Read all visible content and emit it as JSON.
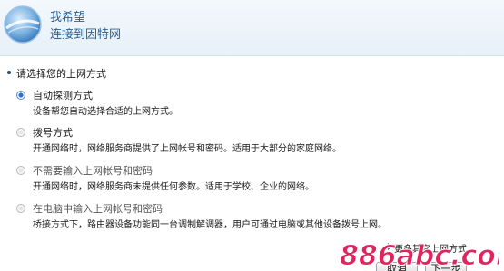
{
  "header": {
    "line1": "我希望",
    "line2": "连接到因特网"
  },
  "prompt": "请选择您的上网方式",
  "options": [
    {
      "title": "自动探测方式",
      "desc": "设备帮您自动选择合适的上网方式。",
      "selected": true
    },
    {
      "title": "拨号方式",
      "desc": "开通网络时，网络服务商提供了上网帐号和密码。适用于大部分的家庭网络。",
      "selected": false
    },
    {
      "title": "不需要输入上网帐号和密码",
      "desc": "开通网络时，网络服务商未提供任何参数。适用于学校、企业的网络。",
      "selected": false
    },
    {
      "title": "在电脑中输入上网帐号和密码",
      "desc": "桥接方式下，路由器设备功能同一台调制解调器，用户可通过电脑或其他设备拨号上网。",
      "selected": false
    }
  ],
  "more_link": "更多其它上网方式",
  "buttons": {
    "cancel": "取消",
    "next": "下一步"
  },
  "watermark": "886abc.com",
  "colors": {
    "accent": "#2f6fd3",
    "header_text": "#2d5f8f",
    "watermark": "#e0245e"
  },
  "icons": {
    "logo": "globe-icon",
    "more": "arrow-right-icon"
  }
}
